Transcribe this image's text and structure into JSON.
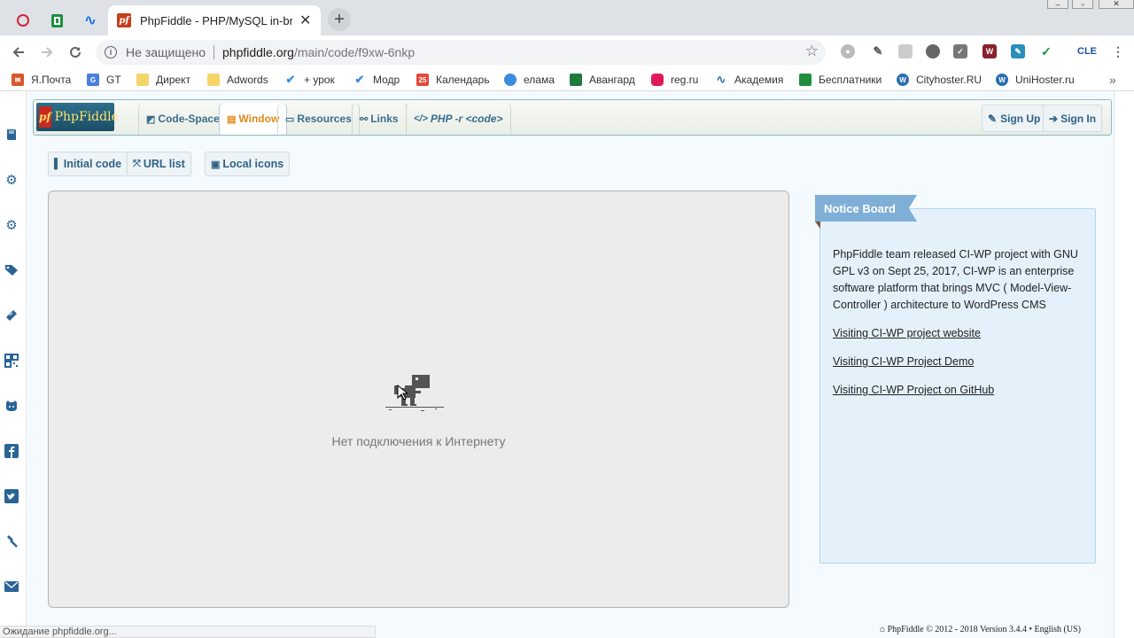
{
  "browser": {
    "tab_title": "PhpFiddle - PHP/MySQL in-brow",
    "tab_favicon_text": "pf",
    "not_secure": "Не защищено",
    "url_host": "phpfiddle.org",
    "url_path": "/main/code/f9xw-6nkp",
    "ext_cle": "CLE"
  },
  "bookmarks": [
    {
      "label": "Я.Почта",
      "icon": "mail-icon",
      "color": "#d6572a"
    },
    {
      "label": "GT",
      "icon": "google-translate-icon",
      "color": "#4a7fe0"
    },
    {
      "label": "Директ",
      "icon": "folder-icon",
      "color": "#f5c542"
    },
    {
      "label": "Adwords",
      "icon": "folder-icon",
      "color": "#f5c542"
    },
    {
      "label": "+ урок",
      "icon": "check-icon",
      "color": "#3a8dde"
    },
    {
      "label": "Модр",
      "icon": "check-icon",
      "color": "#3a8dde"
    },
    {
      "label": "Календарь",
      "icon": "calendar-icon",
      "color": "#e24a3b"
    },
    {
      "label": "елама",
      "icon": "globe-icon",
      "color": "#3a8dde"
    },
    {
      "label": "Авангард",
      "icon": "bank-icon",
      "color": "#1e7a3d"
    },
    {
      "label": "reg.ru",
      "icon": "reg-icon",
      "color": "#e0195a"
    },
    {
      "label": "Академия",
      "icon": "academy-icon",
      "color": "#2a6fb0"
    },
    {
      "label": "Бесплатники",
      "icon": "sheet-icon",
      "color": "#1e8e3e"
    },
    {
      "label": "Cityhoster.RU",
      "icon": "wordpress-icon",
      "color": "#2a6fb0"
    },
    {
      "label": "UniHoster.ru",
      "icon": "wordpress-icon",
      "color": "#2a6fb0"
    }
  ],
  "pf": {
    "logo_text": "PhpFiddle",
    "logo_mark": "pf",
    "tabs": [
      {
        "label": "Code-Space",
        "icon": "code-space-icon"
      },
      {
        "label": "Window",
        "icon": "window-icon"
      },
      {
        "label": "Resources",
        "icon": "resources-icon"
      },
      {
        "label": "Links",
        "icon": "link-icon"
      },
      {
        "label": "PHP -r <code>",
        "icon": "code-icon"
      }
    ],
    "sign_up": "Sign Up",
    "sign_in": "Sign In",
    "buttons": [
      {
        "label": "Initial code",
        "icon": "bookmark-icon"
      },
      {
        "label": "URL list",
        "icon": "expand-icon"
      },
      {
        "label": "Local icons",
        "icon": "image-icon"
      }
    ]
  },
  "window": {
    "offline_message": "Нет подключения к Интернету"
  },
  "notice": {
    "title": "Notice Board",
    "text": "PhpFiddle team released CI-WP project with GNU GPL v3 on Sept 25, 2017, CI-WP is an enterprise software platform that brings MVC ( Model-View-Controller ) architecture to WordPress CMS",
    "links": [
      "Visiting CI-WP project website",
      "Visiting CI-WP Project Demo",
      "Visiting CI-WP Project on GitHub"
    ]
  },
  "footer": {
    "status": "Ожидание phpfiddle.org...",
    "copyright": "PhpFiddle © 2012 - 2018 Version 3.4.4 • English (US)"
  },
  "colors": {
    "accent": "#2e6284",
    "active_tab": "#e08a17",
    "notice_ribbon": "#7fafd6"
  }
}
